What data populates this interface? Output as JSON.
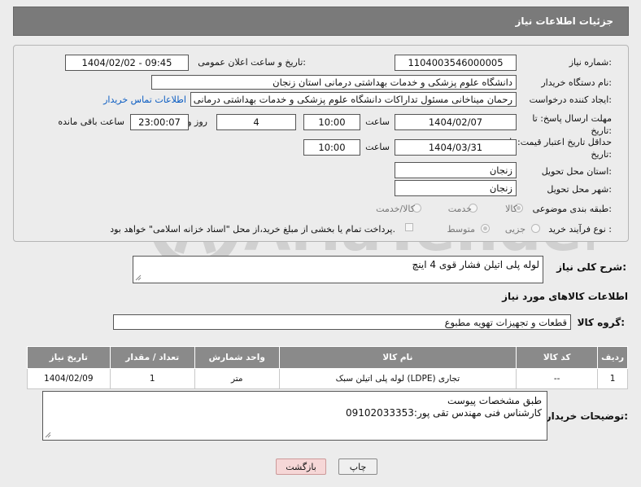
{
  "header": {
    "title": "جزئیات اطلاعات نیاز"
  },
  "form": {
    "need_number_label": "شماره نیاز:",
    "need_number": "1104003546000005",
    "announce_label": "تاریخ و ساعت اعلان عمومی:",
    "announce_value": "1404/02/02 - 09:45",
    "buyer_org_label": "نام دستگاه خریدار:",
    "buyer_org": "دانشگاه علوم پزشکی و خدمات بهداشتی  درمانی استان زنجان",
    "creator_label": "ایجاد کننده درخواست:",
    "creator": "رحمان میناخانی مسئول تداراکات دانشگاه علوم پزشکی و خدمات بهداشتی  درمانی استان زنجان",
    "contact_link": "اطلاعات تماس خریدار",
    "reply_deadline_label": "مهلت ارسال پاسخ: تا تاریخ:",
    "reply_date": "1404/02/07",
    "time_label": "ساعت",
    "reply_time": "10:00",
    "days_count": "4",
    "days_label": "روز و",
    "remaining_time": "23:00:07",
    "remaining_label": "ساعت باقی مانده",
    "price_deadline_label": "حداقل تاریخ اعتبار قیمت: تا تاریخ:",
    "price_date": "1404/03/31",
    "price_time_label": "ساعت",
    "price_time": "10:00",
    "province_label": "استان محل تحویل:",
    "province": "زنجان",
    "city_label": "شهر محل تحویل:",
    "city": "زنجان",
    "category_label": "طبقه بندی موضوعی:",
    "category_options": [
      "کالا",
      "خدمت",
      "کالا/خدمت"
    ],
    "purchase_type_label": "نوع فرآیند خرید :",
    "purchase_options": [
      "جزیی",
      "متوسط"
    ],
    "payment_note": "پرداخت تمام یا بخشی از مبلغ خرید،از محل \"اسناد خزانه اسلامی\" خواهد بود."
  },
  "summary": {
    "label": "شرح کلی نیاز:",
    "value": "لوله پلی اتیلن فشار قوی 4 اینچ"
  },
  "goods": {
    "section_title": "اطلاعات کالاهای مورد نیاز",
    "group_label": "گروه کالا:",
    "group_value": "قطعات و تجهیزات تهویه مطبوع",
    "columns": [
      "ردیف",
      "کد کالا",
      "نام کالا",
      "واحد شمارش",
      "تعداد / مقدار",
      "تاریخ نیاز"
    ],
    "rows": [
      [
        "1",
        "--",
        "لوله پلی اتیلن سبک (LDPE) تجاری",
        "متر",
        "1",
        "1404/02/09"
      ]
    ]
  },
  "buyer_notes": {
    "label": "توضیحات خریدار:",
    "line1": "طبق مشخصات پیوست",
    "line2": "کارشناس فنی مهندس تقی پور:09102033353"
  },
  "buttons": {
    "print": "چاپ",
    "back": "بازگشت"
  },
  "watermark": {
    "text": "AriaTender.neT"
  }
}
